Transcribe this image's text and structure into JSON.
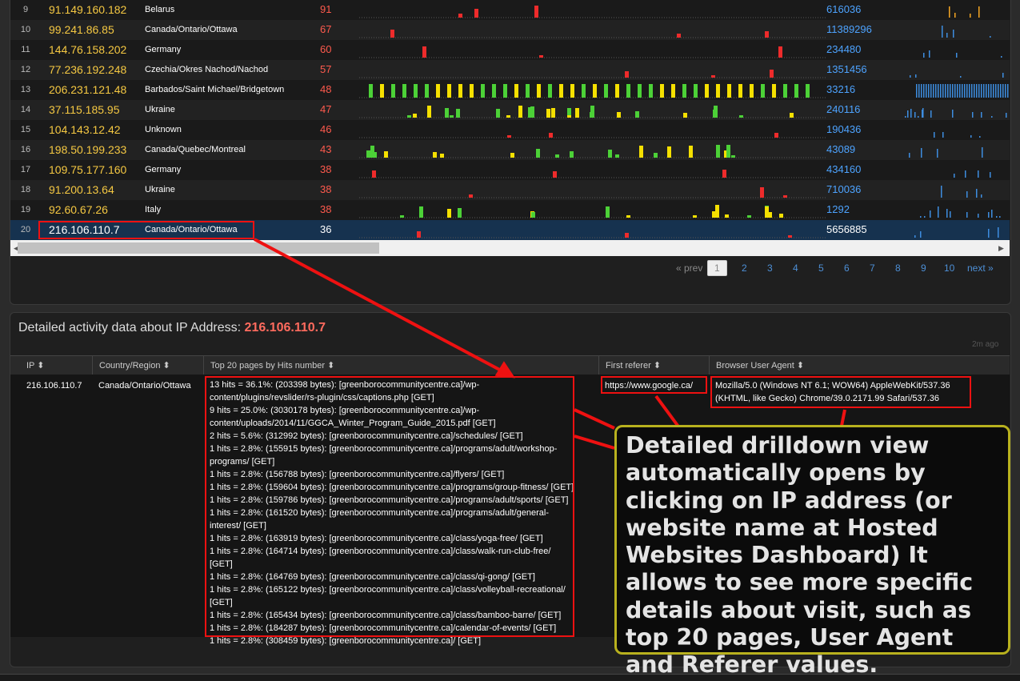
{
  "top_table": {
    "rows": [
      {
        "num": "9",
        "ip": "91.149.160.182",
        "country": "Belarus",
        "hits": "91",
        "bytes": "616036"
      },
      {
        "num": "10",
        "ip": "99.241.86.85",
        "country": "Canada/Ontario/Ottawa",
        "hits": "67",
        "bytes": "11389296"
      },
      {
        "num": "11",
        "ip": "144.76.158.202",
        "country": "Germany",
        "hits": "60",
        "bytes": "234480"
      },
      {
        "num": "12",
        "ip": "77.236.192.248",
        "country": "Czechia/Okres Nachod/Nachod",
        "hits": "57",
        "bytes": "1351456"
      },
      {
        "num": "13",
        "ip": "206.231.121.48",
        "country": "Barbados/Saint Michael/Bridgetown",
        "hits": "48",
        "bytes": "33216"
      },
      {
        "num": "14",
        "ip": "37.115.185.95",
        "country": "Ukraine",
        "hits": "47",
        "bytes": "240116"
      },
      {
        "num": "15",
        "ip": "104.143.12.42",
        "country": "Unknown",
        "hits": "46",
        "bytes": "190436"
      },
      {
        "num": "16",
        "ip": "198.50.199.233",
        "country": "Canada/Quebec/Montreal",
        "hits": "43",
        "bytes": "43089"
      },
      {
        "num": "17",
        "ip": "109.75.177.160",
        "country": "Germany",
        "hits": "38",
        "bytes": "434160"
      },
      {
        "num": "18",
        "ip": "91.200.13.64",
        "country": "Ukraine",
        "hits": "38",
        "bytes": "710036"
      },
      {
        "num": "19",
        "ip": "92.60.67.26",
        "country": "Italy",
        "hits": "38",
        "bytes": "1292"
      },
      {
        "num": "20",
        "ip": "216.106.110.7",
        "country": "Canada/Ontario/Ottawa",
        "hits": "36",
        "bytes": "5656885"
      }
    ],
    "selected_row": 11
  },
  "pagination": {
    "prev": "« prev",
    "pages": [
      "1",
      "2",
      "3",
      "4",
      "5",
      "6",
      "7",
      "8",
      "9",
      "10"
    ],
    "current": "1",
    "next": "next »"
  },
  "detail": {
    "title_prefix": "Detailed activity data about IP Address: ",
    "title_ip": "216.106.110.7",
    "updated": "2m ago",
    "columns": [
      "IP",
      "Country/Region",
      "Top 20 pages by Hits number",
      "First referer",
      "Browser User Agent"
    ],
    "ip": "216.106.110.7",
    "country": "Canada/Ontario/Ottawa",
    "pages": [
      "13 hits = 36.1%: (203398 bytes): [greenborocommunitycentre.ca]/wp-content/plugins/revslider/rs-plugin/css/captions.php [GET]",
      "9 hits = 25.0%: (3030178 bytes): [greenborocommunitycentre.ca]/wp-content/uploads/2014/11/GGCA_Winter_Program_Guide_2015.pdf [GET]",
      "2 hits = 5.6%: (312992 bytes): [greenborocommunitycentre.ca]/schedules/ [GET]",
      "1 hits = 2.8%: (155915 bytes): [greenborocommunitycentre.ca]/programs/adult/workshop-programs/ [GET]",
      "1 hits = 2.8%: (156788 bytes): [greenborocommunitycentre.ca]/flyers/ [GET]",
      "1 hits = 2.8%: (159604 bytes): [greenborocommunitycentre.ca]/programs/group-fitness/ [GET]",
      "1 hits = 2.8%: (159786 bytes): [greenborocommunitycentre.ca]/programs/adult/sports/ [GET]",
      "1 hits = 2.8%: (161520 bytes): [greenborocommunitycentre.ca]/programs/adult/general-interest/ [GET]",
      "1 hits = 2.8%: (163919 bytes): [greenborocommunitycentre.ca]/class/yoga-free/ [GET]",
      "1 hits = 2.8%: (164714 bytes): [greenborocommunitycentre.ca]/class/walk-run-club-free/ [GET]",
      "1 hits = 2.8%: (164769 bytes): [greenborocommunitycentre.ca]/class/qi-gong/ [GET]",
      "1 hits = 2.8%: (165122 bytes): [greenborocommunitycentre.ca]/class/volleyball-recreational/ [GET]",
      "1 hits = 2.8%: (165434 bytes): [greenborocommunitycentre.ca]/class/bamboo-barre/ [GET]",
      "1 hits = 2.8%: (184287 bytes): [greenborocommunitycentre.ca]/calendar-of-events/ [GET]",
      "1 hits = 2.8%: (308459 bytes): [greenborocommunitycentre.ca]/ [GET]"
    ],
    "referer": "https://www.google.ca/",
    "user_agent": "Mozilla/5.0 (Windows NT 6.1; WOW64) AppleWebKit/537.36 (KHTML, like Gecko) Chrome/39.0.2171.99 Safari/537.36"
  },
  "callout": {
    "text": "Detailed drilldown view automatically opens by clicking on IP address (or website name at Hosted Websites Dashboard) It allows to see more specific details about visit, such as top 20 pages, User Agent and Referer values."
  },
  "icons": {
    "sort": "sort-icon",
    "scroll_left": "arrow-left-icon",
    "scroll_right": "arrow-right-icon"
  },
  "colors": {
    "hits": "#ff5a4d",
    "ip": "#f5c842",
    "bytes": "#4da3ff",
    "highlight": "#ee1111",
    "callout_border": "#b8b11e"
  }
}
